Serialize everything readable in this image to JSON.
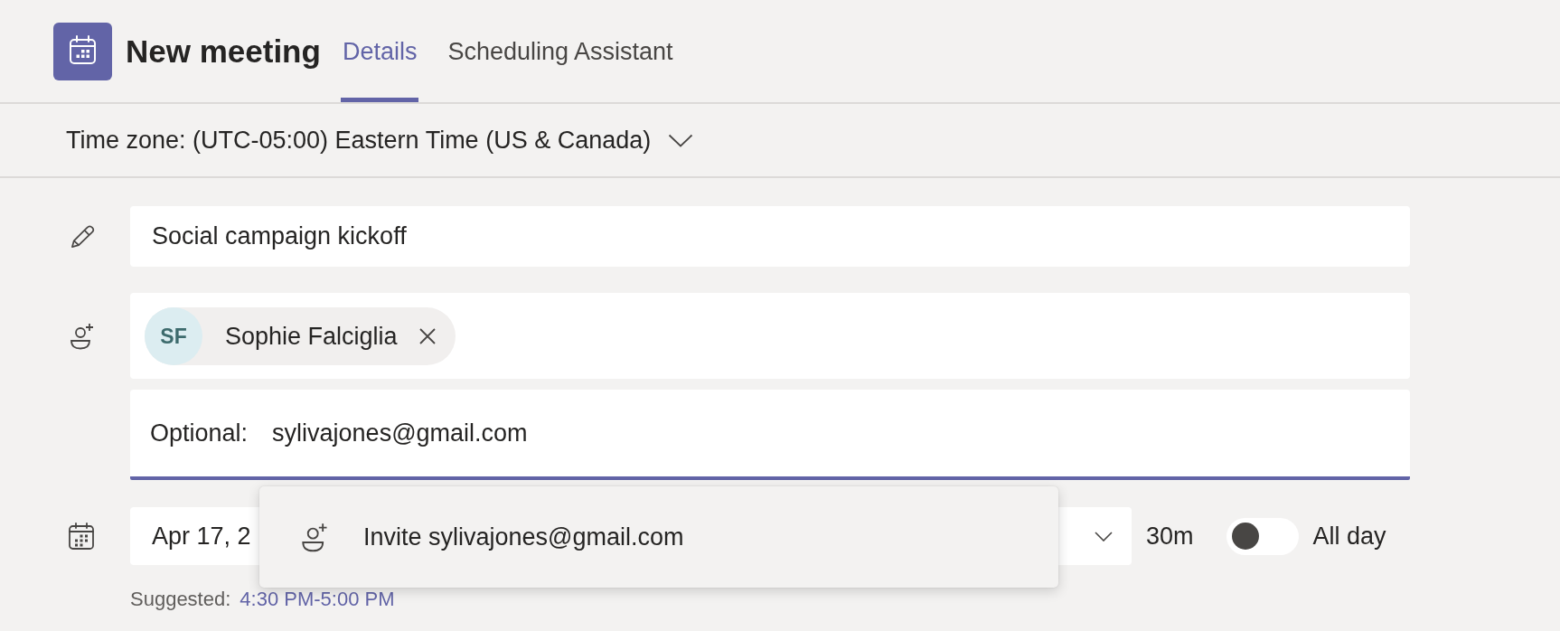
{
  "header": {
    "title": "New meeting",
    "tabs": [
      {
        "label": "Details",
        "selected": true
      },
      {
        "label": "Scheduling Assistant",
        "selected": false
      }
    ]
  },
  "time_zone": {
    "label": "Time zone: (UTC-05:00) Eastern Time (US & Canada)"
  },
  "form": {
    "title_field": {
      "value": "Social campaign kickoff"
    },
    "attendees": [
      {
        "initials": "SF",
        "name": "Sophie Falciglia"
      }
    ],
    "optional_field": {
      "label": "Optional:",
      "value": "sylivajones@gmail.com",
      "focused": true
    },
    "suggestions": [
      {
        "label": "Invite sylivajones@gmail.com"
      }
    ],
    "date_time": {
      "value": "Apr 17, 2"
    },
    "duration": "30m",
    "all_day": {
      "label": "All day",
      "on": false
    },
    "suggested": {
      "label": "Suggested:",
      "time": "4:30 PM-5:00 PM"
    }
  }
}
